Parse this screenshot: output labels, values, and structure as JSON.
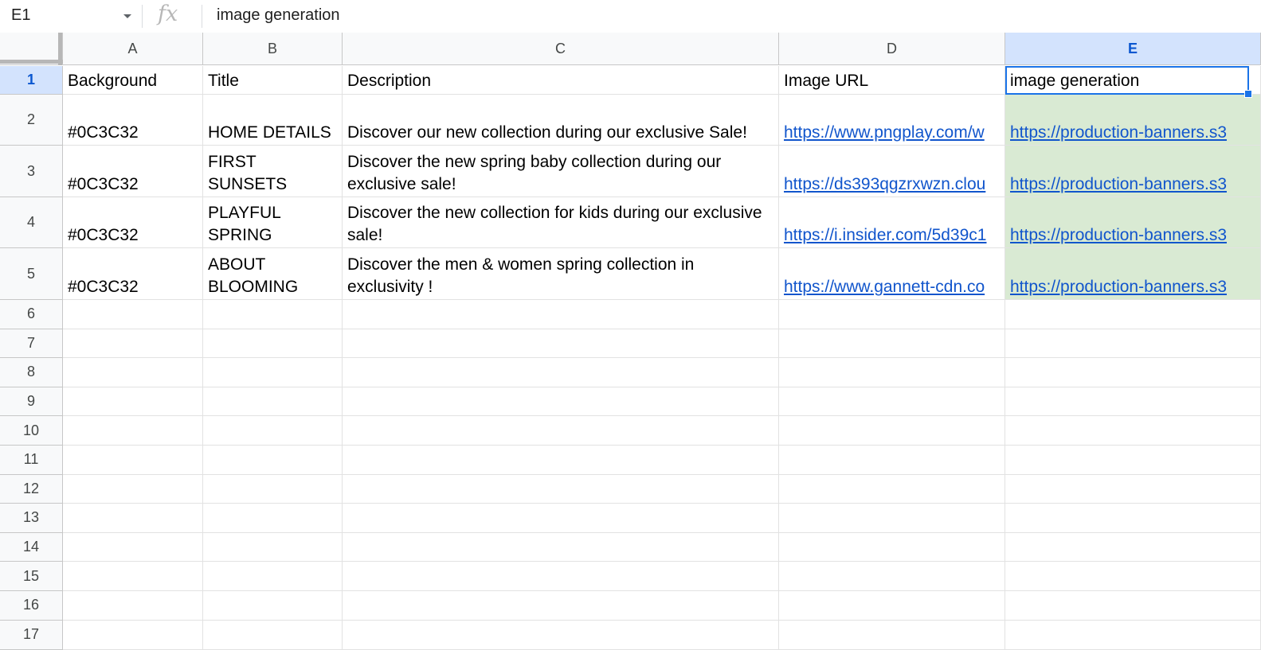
{
  "formula_bar": {
    "name_box": "E1",
    "fx_label": "fx",
    "formula": "image generation"
  },
  "columns": [
    "A",
    "B",
    "C",
    "D",
    "E"
  ],
  "active_column": "E",
  "rows": [
    "1",
    "2",
    "3",
    "4",
    "5",
    "6",
    "7",
    "8",
    "9",
    "10",
    "11",
    "12",
    "13",
    "14",
    "15",
    "16",
    "17"
  ],
  "active_row": "1",
  "selected_cell": "E1",
  "highlight_color": "#d9ead3",
  "selection_color": "#1a73e8",
  "link_color": "#1155cc",
  "cells": [
    {
      "id": "A1",
      "text": "Background"
    },
    {
      "id": "B1",
      "text": "Title"
    },
    {
      "id": "C1",
      "text": "Description"
    },
    {
      "id": "D1",
      "text": "Image URL"
    },
    {
      "id": "E1",
      "text": "image generation"
    },
    {
      "id": "A2",
      "text": "#0C3C32"
    },
    {
      "id": "B2",
      "text": "HOME DETAILS"
    },
    {
      "id": "C2",
      "text": "Discover our new collection during our exclusive Sale!"
    },
    {
      "id": "D2",
      "text": "https://www.pngplay.com/w",
      "link": true
    },
    {
      "id": "E2",
      "text": "https://production-banners.s3",
      "link": true
    },
    {
      "id": "A3",
      "text": "#0C3C32"
    },
    {
      "id": "B3",
      "text": "FIRST SUNSETS"
    },
    {
      "id": "C3",
      "text": "Discover the new spring baby collection during our exclusive sale!"
    },
    {
      "id": "D3",
      "text": "https://ds393qgzrxwzn.clou",
      "link": true
    },
    {
      "id": "E3",
      "text": "https://production-banners.s3",
      "link": true
    },
    {
      "id": "A4",
      "text": "#0C3C32"
    },
    {
      "id": "B4",
      "text": "PLAYFUL SPRING"
    },
    {
      "id": "C4",
      "text": "Discover the new collection for kids during our exclusive sale!"
    },
    {
      "id": "D4",
      "text": "https://i.insider.com/5d39c1",
      "link": true
    },
    {
      "id": "E4",
      "text": "https://production-banners.s3",
      "link": true
    },
    {
      "id": "A5",
      "text": "#0C3C32"
    },
    {
      "id": "B5",
      "text": "ABOUT BLOOMING"
    },
    {
      "id": "C5",
      "text": "Discover the men & women spring collection in exclusivity !"
    },
    {
      "id": "D5",
      "text": "https://www.gannett-cdn.co",
      "link": true
    },
    {
      "id": "E5",
      "text": "https://production-banners.s3",
      "link": true
    }
  ]
}
